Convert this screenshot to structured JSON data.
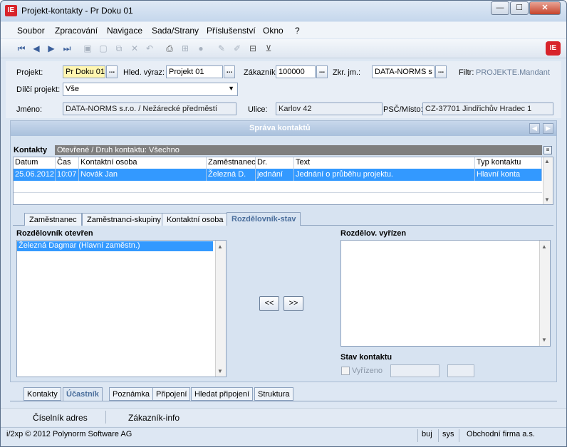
{
  "window": {
    "title": "Projekt-kontakty - Pr Doku 01",
    "app_icon_text": "IE",
    "min": "—",
    "max": "☐",
    "close": "✕"
  },
  "menu": [
    "Soubor",
    "Zpracování",
    "Navigace",
    "Sada/Strany",
    "Příslušenství",
    "Okno",
    "?"
  ],
  "toolbar": {
    "logo_text": "IE"
  },
  "form": {
    "projekt_label": "Projekt:",
    "projekt_value": "Pr Doku 01",
    "hled_label": "Hled. výraz:",
    "hled_value": "Projekt 01",
    "zakaznik_label": "Zákazník",
    "zakaznik_value": "100000",
    "zkr_label": "Zkr. jm.:",
    "zkr_value": "DATA-NORMS s",
    "filtr_label": "Filtr:",
    "filtr_value": "PROJEKTE.Mandant",
    "dilci_label": "Dílčí projekt:",
    "dilci_value": "Vše",
    "jmeno_label": "Jméno:",
    "jmeno_value": "DATA-NORMS s.r.o. / Nežárecké předměstí",
    "ulice_label": "Ulice:",
    "ulice_value": "Karlov 42",
    "psc_label": "PSČ/Místo:",
    "psc_value": "CZ-37701 Jindřichův Hradec 1",
    "dots": "..."
  },
  "panel": {
    "title": "Správa kontaktů",
    "prev": "◀",
    "next": "▶"
  },
  "kontakty": {
    "label": "Kontakty",
    "filter_text": "Otevřené / Druh kontaktu: Všechno",
    "columns": [
      "Datum",
      "Čas",
      "Kontaktní osoba",
      "Zaměstnanec",
      "Dr.",
      "Text",
      "Typ kontaktu"
    ],
    "row": [
      "25.06.2012",
      "10:07",
      "Novák Jan",
      "Železná D.",
      "jednání",
      "Jednání o průběhu projektu.",
      "Hlavní konta"
    ]
  },
  "inner_tabs": [
    "Zaměstnanec",
    "Zaměstnanci-skupiny",
    "Kontaktní osoba",
    "Rozdělovník-stav"
  ],
  "rozdel": {
    "open_title": "Rozdělovník otevřen",
    "open_items": [
      "Železná Dagmar (Hlavní zaměstn.)"
    ],
    "done_title": "Rozdělov. vyřízen",
    "btn_left": "<<",
    "btn_right": ">>",
    "stav_title": "Stav kontaktu",
    "vyrizeno_label": "Vyřízeno"
  },
  "bottom_tabs": [
    "Kontakty",
    "Účastník",
    "Poznámka",
    "Připojení",
    "Hledat připojení",
    "Struktura"
  ],
  "footer_buttons": [
    "Číselník adres",
    "Zákazník-info"
  ],
  "status": {
    "copyright": "i/2xp © 2012 Polynorm Software AG",
    "user": "buj",
    "db": "sys",
    "firm": "Obchodní firma a.s."
  }
}
